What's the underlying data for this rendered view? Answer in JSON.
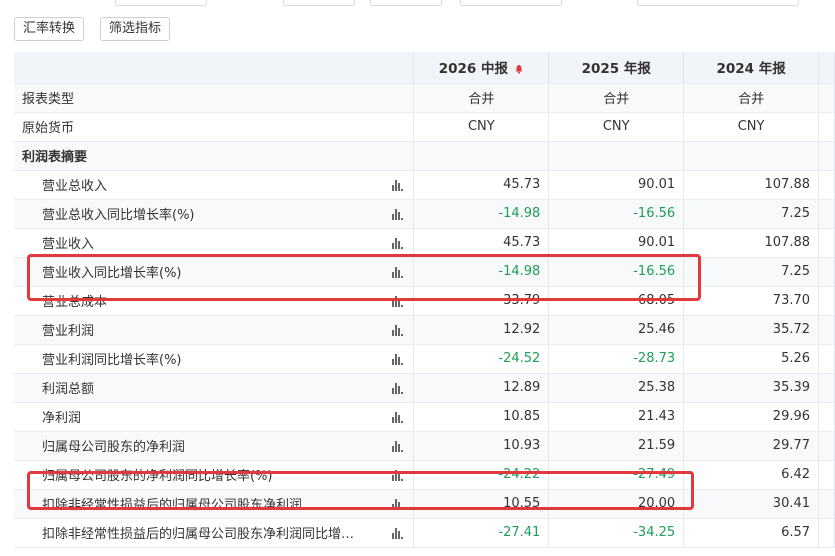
{
  "toolbar": {
    "currency_convert_label": "汇率转换",
    "filter_label": "筛选指标"
  },
  "columns": [
    {
      "label": "2026 中报"
    },
    {
      "label": "2025 年报"
    },
    {
      "label": "2024 年报"
    }
  ],
  "rows": [
    {
      "label": "报表类型",
      "values": [
        "合并",
        "合并",
        "合并"
      ]
    },
    {
      "label": "原始货币",
      "values": [
        "CNY",
        "CNY",
        "CNY"
      ]
    },
    {
      "label": "利润表摘要",
      "values": [
        "",
        "",
        ""
      ]
    },
    {
      "label": "营业总收入",
      "values": [
        "45.73",
        "90.01",
        "107.88"
      ]
    },
    {
      "label": "营业总收入同比增长率(%)",
      "values": [
        "-14.98",
        "-16.56",
        "7.25"
      ]
    },
    {
      "label": "营业收入",
      "values": [
        "45.73",
        "90.01",
        "107.88"
      ]
    },
    {
      "label": "营业收入同比增长率(%)",
      "values": [
        "-14.98",
        "-16.56",
        "7.25"
      ]
    },
    {
      "label": "营业总成本",
      "values": [
        "33.79",
        "68.05",
        "73.70"
      ]
    },
    {
      "label": "营业利润",
      "values": [
        "12.92",
        "25.46",
        "35.72"
      ]
    },
    {
      "label": "营业利润同比增长率(%)",
      "values": [
        "-24.52",
        "-28.73",
        "5.26"
      ]
    },
    {
      "label": "利润总额",
      "values": [
        "12.89",
        "25.38",
        "35.39"
      ]
    },
    {
      "label": "净利润",
      "values": [
        "10.85",
        "21.43",
        "29.96"
      ]
    },
    {
      "label": "归属母公司股东的净利润",
      "values": [
        "10.93",
        "21.59",
        "29.77"
      ]
    },
    {
      "label": "归属母公司股东的净利润同比增长率(%)",
      "values": [
        "-24.22",
        "-27.49",
        "6.42"
      ]
    },
    {
      "label": "扣除非经常性损益后的归属母公司股东净利润",
      "values": [
        "10.55",
        "20.00",
        "30.41"
      ]
    },
    {
      "label": "扣除非经常性损益后的归属母公司股东净利润同比增…",
      "values": [
        "-27.41",
        "-34.25",
        "6.57"
      ]
    }
  ],
  "colors": {
    "negative": "#1e9e57",
    "highlight": "#e0393e",
    "header_bg": "#f1f4f8"
  },
  "icons": {
    "chart": "bar-chart-icon",
    "bell": "bell-icon"
  }
}
